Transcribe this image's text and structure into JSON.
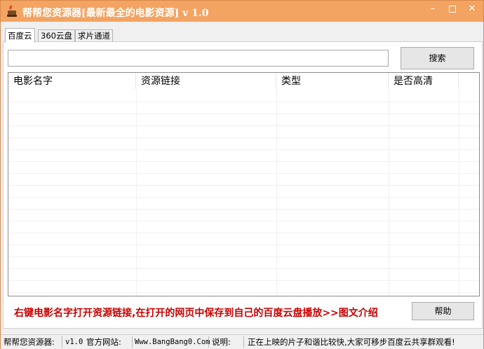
{
  "window": {
    "title": "帮帮您资源器[最新最全的电影资源] v 1.0",
    "minimize_glyph": "–",
    "close_glyph": "✕",
    "accent_color": "#f3a462"
  },
  "tabs": [
    {
      "label": "百度云",
      "active": true
    },
    {
      "label": "360云盘",
      "active": false
    },
    {
      "label": "求片通道",
      "active": false
    }
  ],
  "search": {
    "value": "",
    "placeholder": "",
    "button_label": "搜索"
  },
  "table": {
    "columns": [
      "电影名字",
      "资源链接",
      "类型",
      "是否高清"
    ],
    "rows": []
  },
  "hint": "右键电影名字打开资源链接,在打开的网页中保存到自己的百度云盘播放>>图文介绍",
  "help_button": "帮助",
  "status": {
    "app_label": "帮帮您资源器:",
    "version": "v1.0",
    "site_label": "官方网站:",
    "site_url": "Www.BangBang0.Com",
    "note_label": "说明:",
    "note": "正在上映的片子和谐比较快,大家可移步百度云共享群观看!"
  }
}
